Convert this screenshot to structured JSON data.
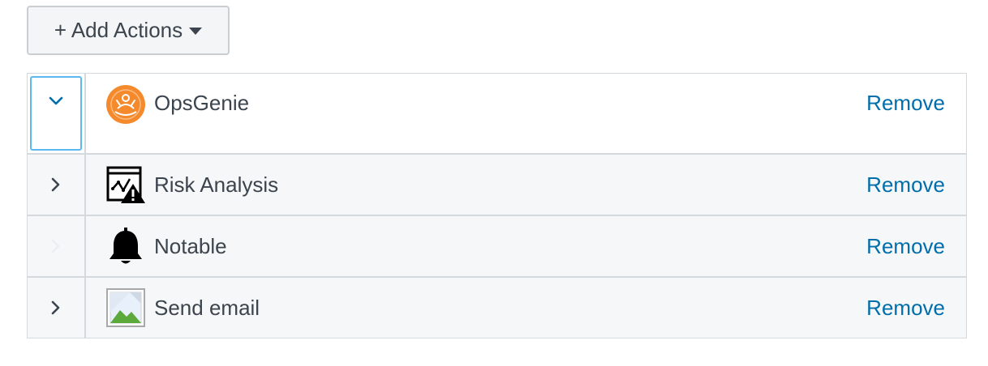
{
  "toolbar": {
    "add_actions_label": "+ Add Actions"
  },
  "actions": [
    {
      "name": "OpsGenie",
      "remove_label": "Remove",
      "icon": "opsgenie-icon",
      "expanded": true,
      "toggle_icon": "chevron-down-icon"
    },
    {
      "name": "Risk Analysis",
      "remove_label": "Remove",
      "icon": "risk-analysis-icon",
      "expanded": false,
      "toggle_icon": "chevron-right-icon"
    },
    {
      "name": "Notable",
      "remove_label": "Remove",
      "icon": "bell-icon",
      "expanded": false,
      "toggle_icon": "chevron-right-icon-disabled"
    },
    {
      "name": "Send email",
      "remove_label": "Remove",
      "icon": "broken-image-icon",
      "expanded": false,
      "toggle_icon": "chevron-right-icon"
    }
  ],
  "colors": {
    "link": "#006eaa",
    "text": "#3c444d",
    "focus_border": "#5cb8f0",
    "row_bg": "#f6f7f9",
    "opsgenie_orange": "#f58a2c"
  }
}
